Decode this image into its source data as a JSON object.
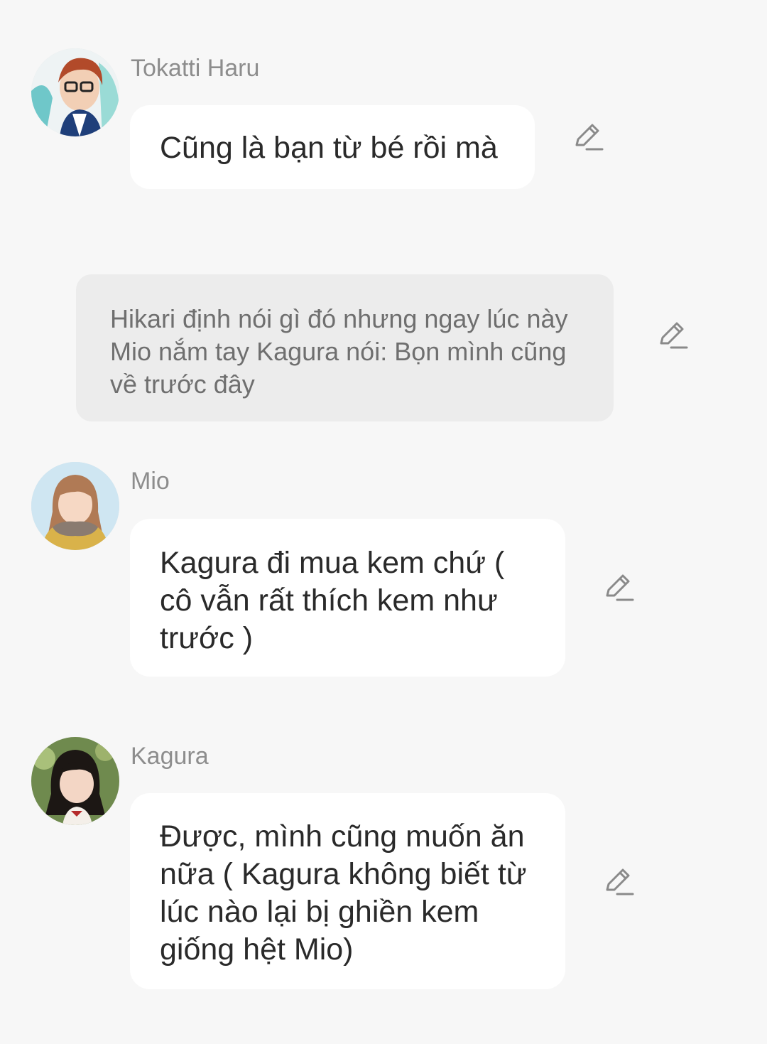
{
  "messages": [
    {
      "sender": "Tokatti Haru",
      "text": "Cũng là bạn từ bé rồi mà",
      "avatar": "tokatti-haru-avatar",
      "action_icon": "edit-pencil-icon"
    },
    {
      "type": "narration",
      "text": "Hikari định nói gì đó nhưng ngay lúc này Mio nắm tay Kagura nói: Bọn mình cũng về trước đây",
      "action_icon": "edit-pencil-icon"
    },
    {
      "sender": "Mio",
      "text": "Kagura đi mua kem chứ ( cô vẫn rất thích kem như trước )",
      "avatar": "mio-avatar",
      "action_icon": "edit-pencil-icon"
    },
    {
      "sender": "Kagura",
      "text": "Được, mình cũng muốn ăn nữa ( Kagura không biết từ lúc nào lại bị ghiền kem giống hệt Mio)",
      "avatar": "kagura-avatar",
      "action_icon": "edit-pencil-icon"
    }
  ],
  "colors": {
    "background": "#f7f7f7",
    "bubble": "#ffffff",
    "narration_bubble": "#ececec",
    "sender_name": "#8d8d8d",
    "icon": "#8a8a8a"
  }
}
